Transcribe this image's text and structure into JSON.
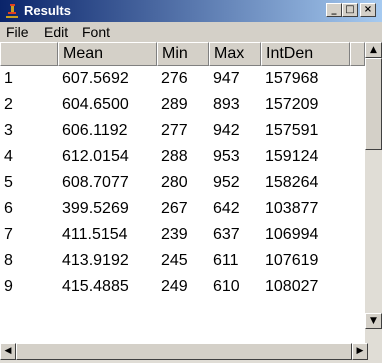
{
  "window": {
    "title": "Results"
  },
  "menu": [
    "File",
    "Edit",
    "Font"
  ],
  "table": {
    "columns": [
      "",
      "Mean",
      "Min",
      "Max",
      "IntDen"
    ],
    "rows": [
      [
        "1",
        "607.5692",
        "276",
        "947",
        "157968"
      ],
      [
        "2",
        "604.6500",
        "289",
        "893",
        "157209"
      ],
      [
        "3",
        "606.1192",
        "277",
        "942",
        "157591"
      ],
      [
        "4",
        "612.0154",
        "288",
        "953",
        "159124"
      ],
      [
        "5",
        "608.7077",
        "280",
        "952",
        "158264"
      ],
      [
        "6",
        "399.5269",
        "267",
        "642",
        "103877"
      ],
      [
        "7",
        "411.5154",
        "239",
        "637",
        "106994"
      ],
      [
        "8",
        "413.9192",
        "245",
        "611",
        "107619"
      ],
      [
        "9",
        "415.4885",
        "249",
        "610",
        "108027"
      ]
    ]
  },
  "colors": {
    "titlebar_start": "#0a246a",
    "titlebar_end": "#a6caf0",
    "chrome": "#d4d0c8"
  },
  "icons": {
    "app": "imagej-microscope-icon",
    "minimize": "minimize-icon",
    "maximize": "maximize-icon",
    "close": "close-icon"
  }
}
